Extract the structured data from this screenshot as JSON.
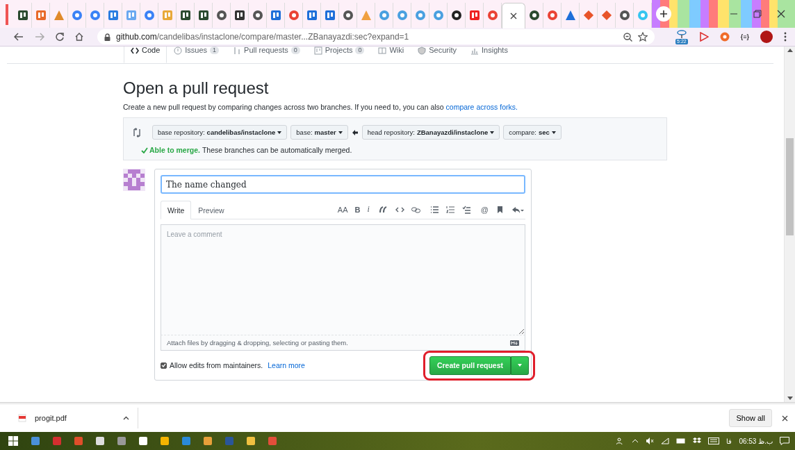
{
  "address_bar": {
    "host": "github.com",
    "path": "/candelibas/instaclone/compare/master...ZBanayazdi:sec?expand=1"
  },
  "extensions": {
    "timer_badge": "5:22",
    "json_label": "{≡}"
  },
  "repo_nav": [
    {
      "label": "Code",
      "selected": true
    },
    {
      "label": "Issues",
      "count": "1",
      "selected": false
    },
    {
      "label": "Pull requests",
      "count": "0",
      "selected": false
    },
    {
      "label": "Projects",
      "count": "0",
      "selected": false
    },
    {
      "label": "Wiki",
      "selected": false
    },
    {
      "label": "Security",
      "selected": false
    },
    {
      "label": "Insights",
      "selected": false
    }
  ],
  "page": {
    "title": "Open a pull request",
    "description": "Create a new pull request by comparing changes across two branches. If you need to, you can also",
    "description_link": "compare across forks."
  },
  "range_selectors": [
    {
      "label": "base repository:",
      "value": "candelibas/instaclone"
    },
    {
      "label": "base:",
      "value": "master"
    },
    {
      "label": "head repository:",
      "value": "ZBanayazdi/instaclone"
    },
    {
      "label": "compare:",
      "value": "sec"
    }
  ],
  "merge_status": {
    "status": "Able to merge.",
    "message": "These branches can be automatically merged."
  },
  "form": {
    "title_value": "The name changed",
    "editor_tabs": [
      {
        "label": "Write",
        "selected": true
      },
      {
        "label": "Preview",
        "selected": false
      }
    ],
    "toolbar_text": [
      "AA",
      "B",
      "i",
      "@"
    ],
    "comment_placeholder": "Leave a comment",
    "attach_hint": "Attach files by dragging & dropping, selecting or pasting them.",
    "allow_edits": {
      "label": "Allow edits from maintainers.",
      "checked": true,
      "link": "Learn more"
    },
    "submit_button": "Create pull request",
    "submit_highlighted": true
  },
  "downloads": {
    "file": "progit.pdf",
    "show_all": "Show all"
  },
  "taskbar": {
    "language": "فا",
    "time": "06:53 ب.ظ"
  }
}
